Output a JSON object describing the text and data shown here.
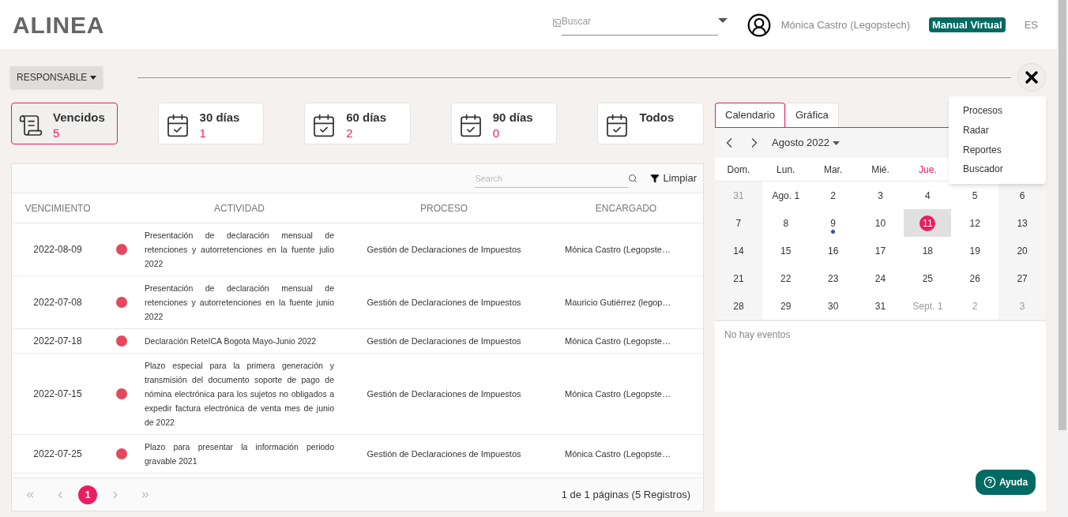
{
  "header": {
    "logo": "ALINEA",
    "search": {
      "placeholder": "Buscar"
    },
    "user": "Mónica Castro (Legopstech)",
    "manual": "Manual Virtual",
    "language": "ES"
  },
  "filter": {
    "label": "RESPONSABLE"
  },
  "cards": [
    {
      "kind": "overdue",
      "label": "Vencidos",
      "count": "5",
      "selected": true
    },
    {
      "kind": "calendar",
      "label": "30 días",
      "count": "1",
      "selected": false
    },
    {
      "kind": "calendar",
      "label": "60 días",
      "count": "2",
      "selected": false
    },
    {
      "kind": "calendar",
      "label": "90 días",
      "count": "0",
      "selected": false
    },
    {
      "kind": "calendar",
      "label": "Todos",
      "selected": false
    }
  ],
  "table": {
    "search": {
      "placeholder": "Search"
    },
    "clear": "Limpiar",
    "columns": [
      "VENCIMIENTO",
      "ACTIVIDAD",
      "PROCESO",
      "ENCARGADO"
    ],
    "rows": [
      {
        "date": "2022-08-09",
        "color": "#e5485c",
        "activity": "Presentación de declaración mensual de retenciones y autorretenciones en la fuente julio 2022",
        "process": "Gestión de Declaraciones de Impuestos",
        "owner": "Mónica Castro (Legopste…"
      },
      {
        "date": "2022-07-08",
        "color": "#e5485c",
        "activity": "Presentación de declaración mensual de retenciones y autorretenciones en la fuente junio 2022",
        "process": "Gestión de Declaraciones de Impuestos",
        "owner": "Mauricio Gutiérrez (legop…"
      },
      {
        "date": "2022-07-18",
        "color": "#e5485c",
        "activity": "Declaración ReteICA Bogota Mayo-Junio 2022",
        "process": "Gestión de Declaraciones de Impuestos",
        "owner": "Mónica Castro (Legopste…"
      },
      {
        "date": "2022-07-15",
        "color": "#e5485c",
        "activity": "Plazo especial para la primera generación y transmisión del documento soporte de pago de nómina electrónica para los sujetos no obligados a expedir factura electrónica de venta mes de junio de 2022",
        "process": "Gestión de Declaraciones de Impuestos",
        "owner": "Mónica Castro (Legopste…"
      },
      {
        "date": "2022-07-25",
        "color": "#e5485c",
        "activity": "Plazo para presentar la información periodo gravable 2021",
        "process": "Gestión de Declaraciones de Impuestos",
        "owner": "Mónica Castro (Legopste…"
      }
    ],
    "pagination": {
      "pages": [
        {
          "label": "1",
          "selected": true
        }
      ],
      "summary": "1 de 1 páginas (5 Registros)"
    }
  },
  "calendar": {
    "tabs": [
      {
        "label": "Calendario",
        "selected": true
      },
      {
        "label": "Gráfica",
        "selected": false
      }
    ],
    "month": "Agosto 2022",
    "weekdays": [
      {
        "label": "Dom.",
        "today": false
      },
      {
        "label": "Lun.",
        "today": false
      },
      {
        "label": "Mar.",
        "today": false
      },
      {
        "label": "Mié.",
        "today": false
      },
      {
        "label": "Jue.",
        "today": true
      }
    ],
    "days": [
      {
        "label": "31",
        "muted": true,
        "selected": false,
        "event": false
      },
      {
        "label": "Ago. 1",
        "muted": false,
        "selected": false,
        "event": false
      },
      {
        "label": "2",
        "muted": false,
        "selected": false,
        "event": false
      },
      {
        "label": "3",
        "muted": false,
        "selected": false,
        "event": false
      },
      {
        "label": "4",
        "muted": false,
        "selected": false,
        "event": false
      },
      {
        "label": "5",
        "muted": false,
        "selected": false,
        "event": false
      },
      {
        "label": "6",
        "muted": false,
        "selected": false,
        "event": false
      },
      {
        "label": "7",
        "muted": false,
        "selected": false,
        "event": false
      },
      {
        "label": "8",
        "muted": false,
        "selected": false,
        "event": false
      },
      {
        "label": "9",
        "muted": false,
        "selected": false,
        "event": true
      },
      {
        "label": "10",
        "muted": false,
        "selected": false,
        "event": false
      },
      {
        "label": "11",
        "muted": false,
        "selected": true,
        "event": false
      },
      {
        "label": "12",
        "muted": false,
        "selected": false,
        "event": false
      },
      {
        "label": "13",
        "muted": false,
        "selected": false,
        "event": false
      },
      {
        "label": "14",
        "muted": false,
        "selected": false,
        "event": false
      },
      {
        "label": "15",
        "muted": false,
        "selected": false,
        "event": false
      },
      {
        "label": "16",
        "muted": false,
        "selected": false,
        "event": false
      },
      {
        "label": "17",
        "muted": false,
        "selected": false,
        "event": false
      },
      {
        "label": "18",
        "muted": false,
        "selected": false,
        "event": false
      },
      {
        "label": "19",
        "muted": false,
        "selected": false,
        "event": false
      },
      {
        "label": "20",
        "muted": false,
        "selected": false,
        "event": false
      },
      {
        "label": "21",
        "muted": false,
        "selected": false,
        "event": false
      },
      {
        "label": "22",
        "muted": false,
        "selected": false,
        "event": false
      },
      {
        "label": "23",
        "muted": false,
        "selected": false,
        "event": false
      },
      {
        "label": "24",
        "muted": false,
        "selected": false,
        "event": false
      },
      {
        "label": "25",
        "muted": false,
        "selected": false,
        "event": false
      },
      {
        "label": "26",
        "muted": false,
        "selected": false,
        "event": false
      },
      {
        "label": "27",
        "muted": false,
        "selected": false,
        "event": false
      },
      {
        "label": "28",
        "muted": false,
        "selected": false,
        "event": false
      },
      {
        "label": "29",
        "muted": false,
        "selected": false,
        "event": false
      },
      {
        "label": "30",
        "muted": false,
        "selected": false,
        "event": false
      },
      {
        "label": "31",
        "muted": false,
        "selected": false,
        "event": false
      },
      {
        "label": "Sept. 1",
        "muted": true,
        "selected": false,
        "event": false
      },
      {
        "label": "2",
        "muted": true,
        "selected": false,
        "event": false
      },
      {
        "label": "3",
        "muted": true,
        "selected": false,
        "event": false
      }
    ],
    "empty": "No hay eventos"
  },
  "menu": [
    "Procesos",
    "Radar",
    "Reportes",
    "Buscador"
  ],
  "help": "Ayuda"
}
